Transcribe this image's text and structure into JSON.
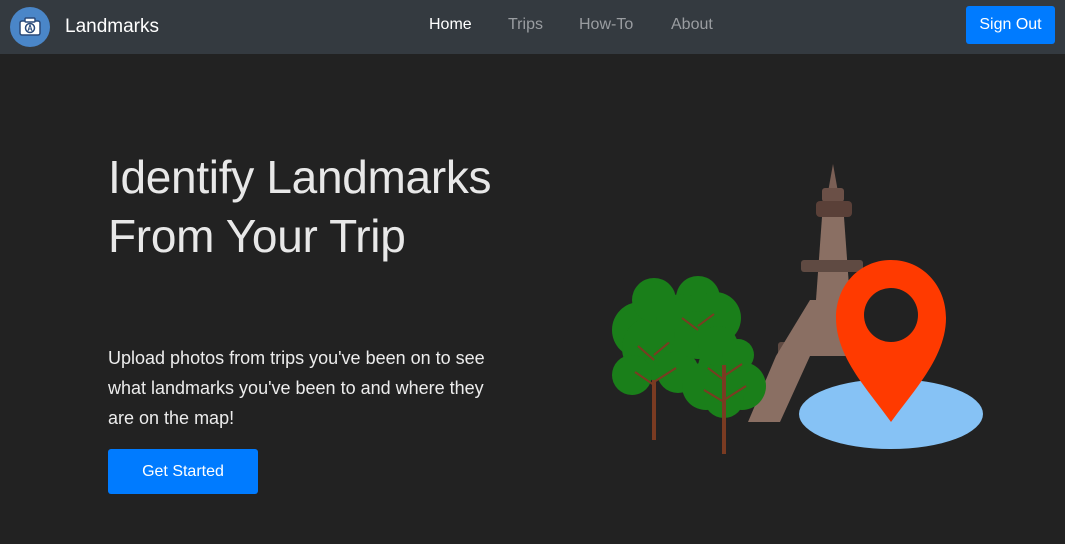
{
  "app": {
    "name": "Landmarks",
    "logo_icon": "camera-icon"
  },
  "nav": {
    "items": [
      {
        "label": "Home",
        "active": true
      },
      {
        "label": "Trips",
        "active": false
      },
      {
        "label": "How-To",
        "active": false
      },
      {
        "label": "About",
        "active": false
      }
    ],
    "sign_out_label": "Sign Out"
  },
  "hero": {
    "title": "Identify Landmarks From Your Trip",
    "subtitle": "Upload photos from trips you've been on to see what landmarks you've been to and where they are on the map!",
    "cta_label": "Get Started"
  },
  "illustration": {
    "icons": [
      "tree-icon",
      "eiffel-tower-icon",
      "map-pin-icon"
    ]
  },
  "colors": {
    "page_bg": "#222222",
    "navbar_bg": "#343a40",
    "primary": "#007bff",
    "pin": "#ff3a00",
    "water": "#86c2f5",
    "tree": "#1a7f1a",
    "tower": "#8a6f63"
  }
}
